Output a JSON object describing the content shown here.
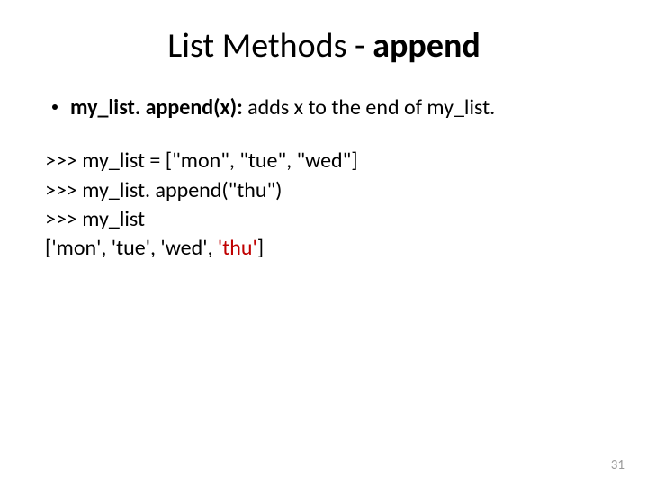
{
  "title_prefix": "List Methods - ",
  "title_bold": "append",
  "bullet": {
    "method_bold": "my_list. append(x):",
    "desc": " adds x to the end of my_list."
  },
  "code": {
    "line1": ">>> my_list = [\"mon\", \"tue\", \"wed\"]",
    "line2": ">>> my_list. append(\"thu\")",
    "line3": ">>> my_list",
    "line4_prefix": "['mon', 'tue', 'wed', ",
    "line4_highlight": "'thu'",
    "line4_suffix": "]"
  },
  "page_number": "31"
}
